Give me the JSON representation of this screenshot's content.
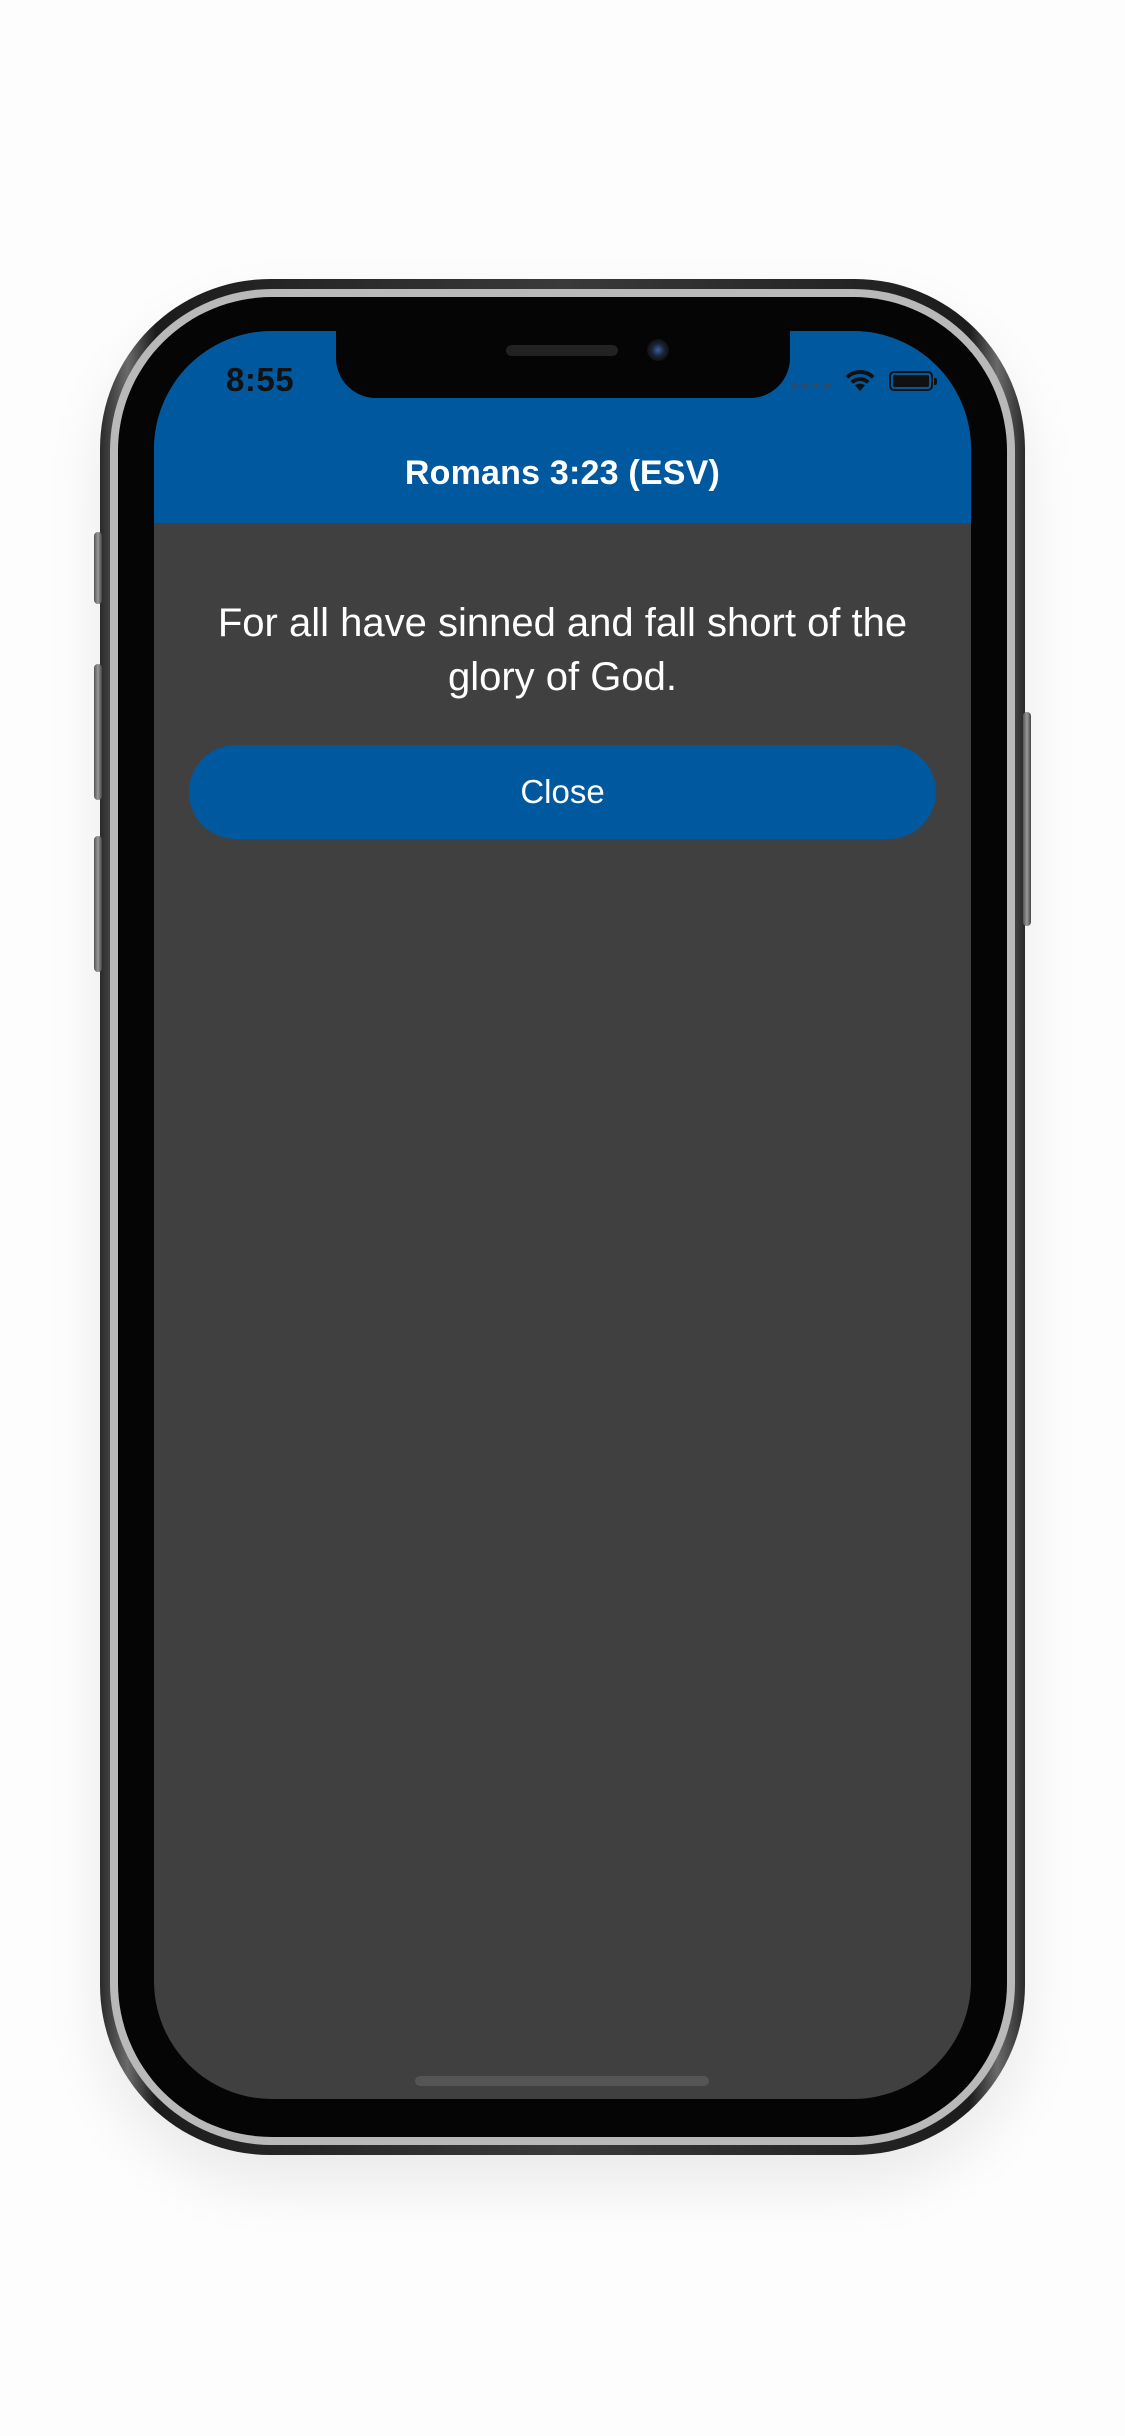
{
  "status_bar": {
    "time": "8:55",
    "icons": [
      "cellular-signal-icon",
      "wifi-icon",
      "battery-icon"
    ]
  },
  "header": {
    "title": "Romans 3:23 (ESV)"
  },
  "content": {
    "verse_text": "For all have sinned and fall short of the glory of God."
  },
  "actions": {
    "close_label": "Close"
  },
  "colors": {
    "accent": "#00589f",
    "background": "#404040",
    "text": "#ffffff"
  }
}
